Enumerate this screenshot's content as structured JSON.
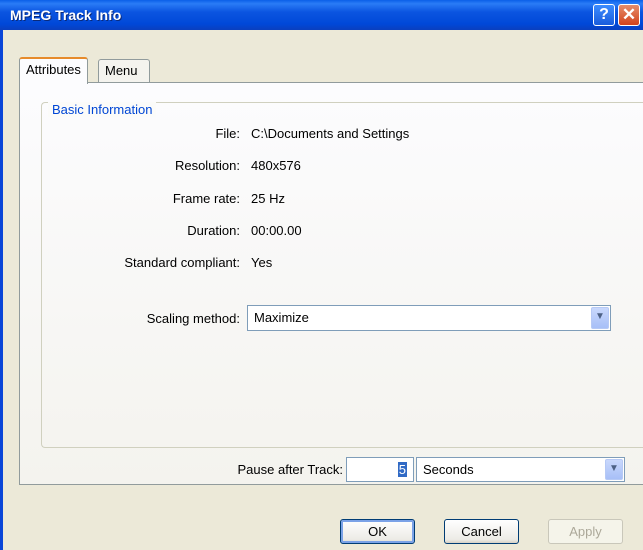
{
  "window": {
    "title": "MPEG Track Info",
    "help_glyph": "?",
    "close_glyph": "✕"
  },
  "tabs": [
    {
      "label": "Attributes",
      "active": true
    },
    {
      "label": "Menu",
      "active": false
    }
  ],
  "basic_info": {
    "group_title": "Basic Information",
    "fields": [
      {
        "label": "File:",
        "value": "C:\\Documents and Settings"
      },
      {
        "label": "Resolution:",
        "value": "480x576"
      },
      {
        "label": "Frame rate:",
        "value": "25 Hz"
      },
      {
        "label": "Duration:",
        "value": "00:00.00"
      },
      {
        "label": "Standard compliant:",
        "value": "Yes"
      }
    ],
    "scaling": {
      "label": "Scaling method:",
      "value": "Maximize"
    }
  },
  "pause": {
    "label": "Pause after Track:",
    "value": "5",
    "unit": "Seconds"
  },
  "buttons": {
    "ok": "OK",
    "cancel": "Cancel",
    "apply": "Apply"
  },
  "icons": {
    "dropdown": "▼"
  }
}
